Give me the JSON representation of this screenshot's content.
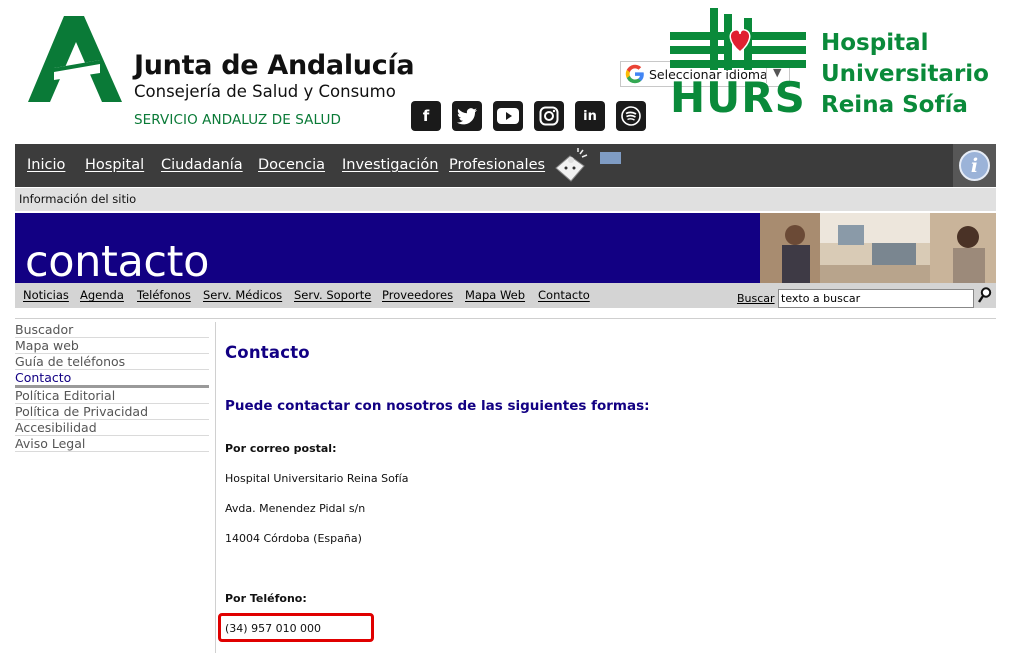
{
  "header": {
    "junta_title": "Junta de Andalucía",
    "junta_subtitle": "Consejería de Salud y Consumo",
    "junta_service": "SERVICIO ANDALUZ DE SALUD",
    "language_selector": "Seleccionar idioma",
    "hospital_abbrev": "HURS",
    "hospital_name_lines": [
      "Hospital",
      "Universitario",
      "Reina Sofía"
    ],
    "social_icons": [
      "facebook-icon",
      "twitter-icon",
      "youtube-icon",
      "instagram-icon",
      "linkedin-icon",
      "podcast-icon"
    ],
    "colors": {
      "junta_green": "#0a7a37",
      "hurs_green": "#0a8a3a"
    }
  },
  "main_nav": {
    "items": [
      "Inicio",
      "Hospital",
      "Ciudadanía",
      "Docencia",
      "Investigación",
      "Profesionales"
    ],
    "info_icon": "info-icon"
  },
  "site_info": "Información del sitio",
  "banner": {
    "title": "contacto",
    "color": "#120083"
  },
  "sub_nav": {
    "items": [
      "Noticias",
      "Agenda",
      "Teléfonos",
      "Serv. Médicos",
      "Serv. Soporte",
      "Proveedores",
      "Mapa Web",
      "Contacto"
    ],
    "search_label": "Buscar",
    "search_value": "texto a buscar"
  },
  "sidebar": {
    "items": [
      "Buscador",
      "Mapa web",
      "Guía de teléfonos",
      "Contacto",
      "Política Editorial",
      "Política de Privacidad",
      "Accesibilidad",
      "Aviso Legal"
    ],
    "active": "Contacto"
  },
  "content": {
    "title": "Contacto",
    "subtitle": "Puede contactar con nosotros de las siguientes formas:",
    "postal_heading": "Por correo postal:",
    "postal_lines": [
      "Hospital Universitario Reina Sofía",
      "Avda. Menendez Pidal s/n",
      "14004 Córdoba  (España)"
    ],
    "phone_heading": "Por Teléfono:",
    "phone": "(34)  957 010 000"
  }
}
